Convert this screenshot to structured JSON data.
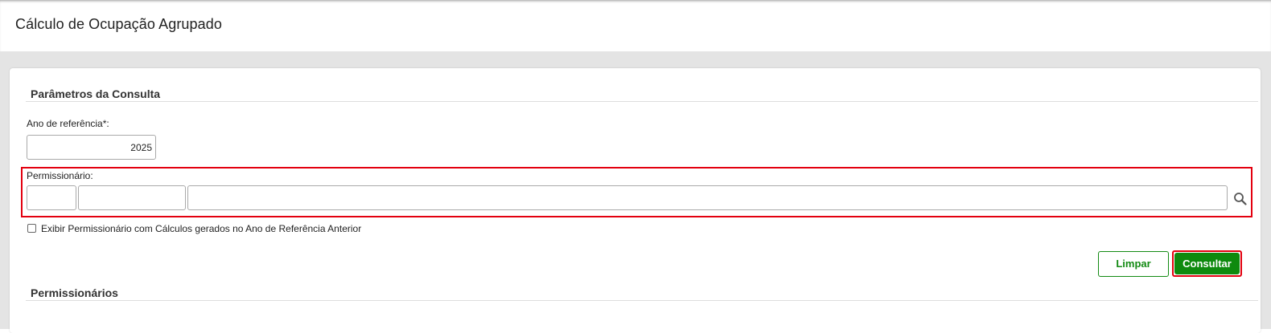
{
  "page": {
    "title": "Cálculo de Ocupação Agrupado"
  },
  "params_section": {
    "title": "Parâmetros da Consulta",
    "year_label": "Ano de referência*:",
    "year_value": "2025",
    "permissionario_label": "Permissionário:",
    "permissionario_code": "",
    "permissionario_doc": "",
    "permissionario_name": "",
    "search_icon": "search-icon",
    "checkbox_label": "Exibir Permissionário com Cálculos gerados no Ano de Referência Anterior",
    "checkbox_checked": false
  },
  "actions": {
    "clear_label": "Limpar",
    "submit_label": "Consultar"
  },
  "results_section": {
    "title": "Permissionários"
  },
  "colors": {
    "accent_green": "#0e8a0e",
    "highlight_red": "#e3000f",
    "background_gray": "#e4e4e4"
  }
}
